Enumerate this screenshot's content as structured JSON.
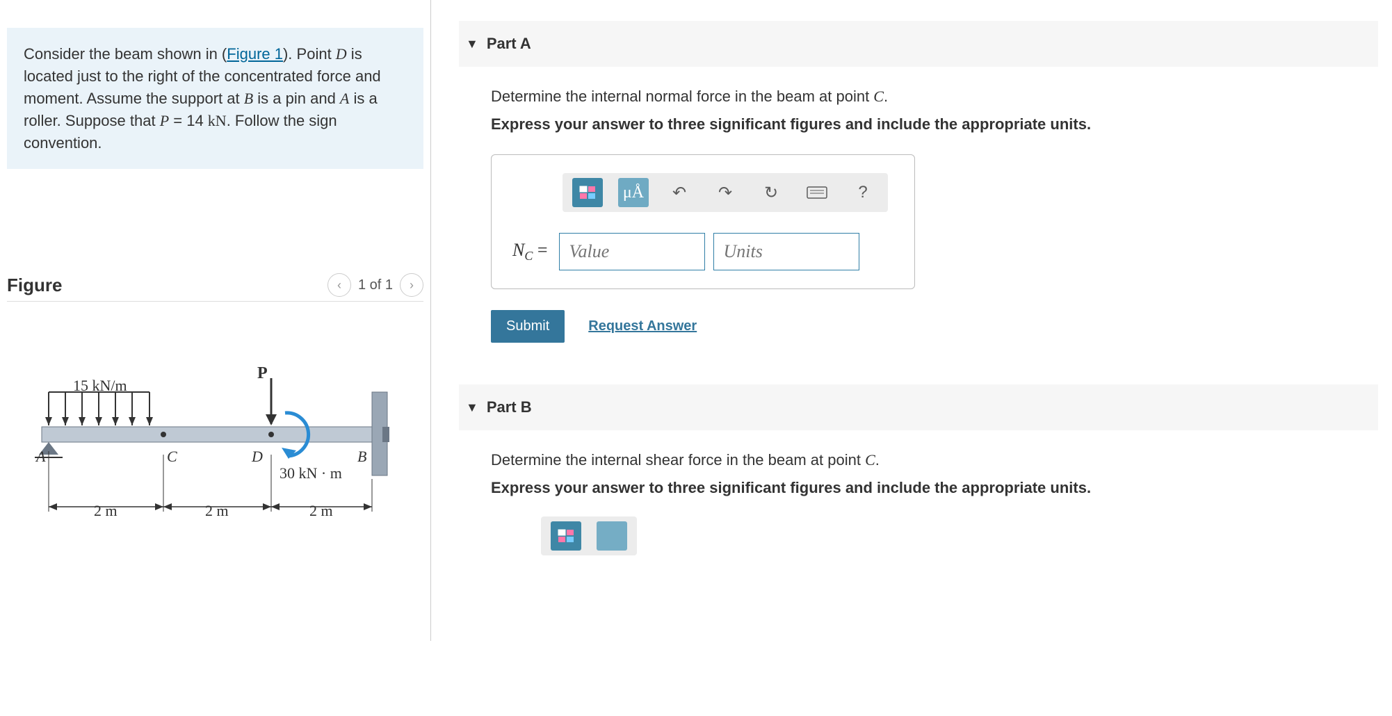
{
  "problem": {
    "text_pre": "Consider the beam shown in (",
    "fig_link": "Figure 1",
    "text_mid1": "). Point ",
    "D": "D",
    "text_mid2": " is located just to the right of the concentrated force and moment. Assume the support at ",
    "B": "B",
    "text_mid3": " is a pin and ",
    "A": "A",
    "text_mid4": " is a roller. Suppose that ",
    "P": "P",
    "eq": " = 14 ",
    "unit": "kN",
    "text_end": ". Follow the sign convention."
  },
  "figure": {
    "title": "Figure",
    "pager": "1 of 1",
    "dist_load": "15 kN/m",
    "P_label": "P",
    "moment": "30 kN · m",
    "ptA": "A",
    "ptB": "B",
    "ptC": "C",
    "ptD": "D",
    "d1": "2 m",
    "d2": "2 m",
    "d3": "2 m"
  },
  "partA": {
    "title": "Part A",
    "prompt_pre": "Determine the internal normal force in the beam at point ",
    "C": "C",
    "prompt_post": ".",
    "sub": "Express your answer to three significant figures and include the appropriate units.",
    "var_html": "N",
    "var_sub": "C",
    "eq": " =",
    "value_ph": "Value",
    "units_ph": "Units",
    "submit": "Submit",
    "request": "Request Answer",
    "t_mu": "μÅ",
    "t_help": "?"
  },
  "partB": {
    "title": "Part B",
    "prompt_pre": "Determine the internal shear force in the beam at point ",
    "C": "C",
    "prompt_post": ".",
    "sub": "Express your answer to three significant figures and include the appropriate units."
  }
}
